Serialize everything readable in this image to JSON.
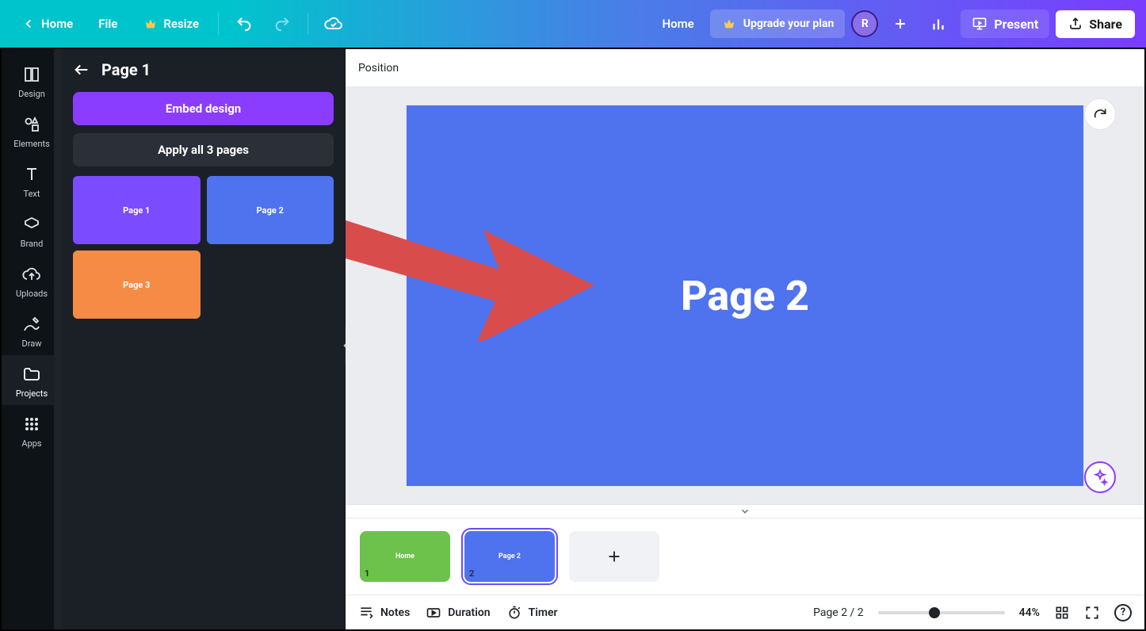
{
  "topbar": {
    "home": "Home",
    "file": "File",
    "resize": "Resize",
    "home_right": "Home",
    "upgrade": "Upgrade your plan",
    "avatar_initial": "R",
    "present": "Present",
    "share": "Share"
  },
  "leftnav": {
    "items": [
      {
        "label": "Design",
        "icon": "design"
      },
      {
        "label": "Elements",
        "icon": "elements"
      },
      {
        "label": "Text",
        "icon": "text"
      },
      {
        "label": "Brand",
        "icon": "brand"
      },
      {
        "label": "Uploads",
        "icon": "uploads"
      },
      {
        "label": "Draw",
        "icon": "draw"
      },
      {
        "label": "Projects",
        "icon": "projects",
        "active": true
      },
      {
        "label": "Apps",
        "icon": "apps"
      }
    ]
  },
  "panel": {
    "title": "Page 1",
    "embed_btn": "Embed design",
    "apply_btn": "Apply all 3 pages",
    "thumbs": [
      {
        "label": "Page 1",
        "color": "#7a4bff"
      },
      {
        "label": "Page 2",
        "color": "#4f72ef"
      },
      {
        "label": "Page 3",
        "color": "#f58b45"
      }
    ]
  },
  "context": {
    "position": "Position"
  },
  "canvas": {
    "slide_text": "Page 2"
  },
  "filmstrip": {
    "thumbs": [
      {
        "label": "Home",
        "index": "1",
        "style": "green"
      },
      {
        "label": "Page 2",
        "index": "2",
        "style": "blue"
      }
    ]
  },
  "bottombar": {
    "notes": "Notes",
    "duration": "Duration",
    "timer": "Timer",
    "page_indicator": "Page 2 / 2",
    "zoom_label": "44%",
    "zoom_position_pct": 40,
    "help": "?"
  }
}
